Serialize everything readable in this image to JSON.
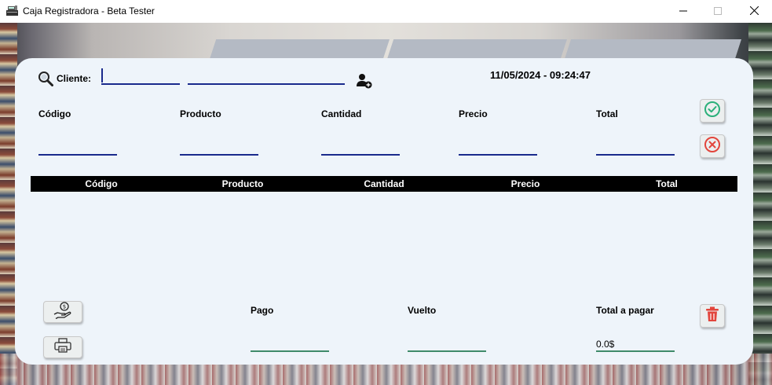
{
  "window": {
    "title": "Caja Registradora - Beta Tester",
    "icon": "cash-register-icon",
    "controls": [
      "minimize-icon",
      "maximize-icon",
      "close-icon"
    ]
  },
  "tabs": [
    {
      "label": ""
    },
    {
      "label": ""
    },
    {
      "label": ""
    }
  ],
  "header": {
    "search_icon": "search-icon",
    "client_label": "Cliente:",
    "client_id_value": "",
    "client_name_value": "",
    "add_client_icon": "add-user-icon",
    "datetime": "11/05/2024 - 09:24:47"
  },
  "entry_form": {
    "fields": [
      {
        "label": "Código",
        "value": ""
      },
      {
        "label": "Producto",
        "value": ""
      },
      {
        "label": "Cantidad",
        "value": ""
      },
      {
        "label": "Precio",
        "value": ""
      },
      {
        "label": "Total",
        "value": ""
      }
    ],
    "confirm_icon": "check-circle-icon",
    "cancel_icon": "x-circle-icon"
  },
  "table": {
    "columns": [
      "Código",
      "Producto",
      "Cantidad",
      "Precio",
      "Total"
    ],
    "rows": []
  },
  "footer": {
    "pay_icon": "hand-money-icon",
    "print_icon": "printer-icon",
    "pago_label": "Pago",
    "pago_value": "",
    "vuelto_label": "Vuelto",
    "vuelto_value": "",
    "total_label": "Total a pagar",
    "total_value": "0.0$",
    "delete_icon": "trash-icon"
  },
  "colors": {
    "panel_bg": "#eef4fa",
    "tab_bg": "#b4bac4",
    "input_line_blue": "#1a2a8c",
    "input_line_green": "#3f8a6a",
    "confirm_green": "#2bb07a",
    "cancel_red": "#e2453c",
    "table_header_bg": "#000000"
  }
}
